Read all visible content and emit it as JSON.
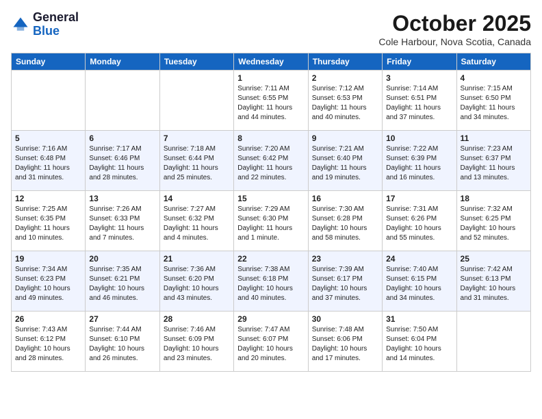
{
  "header": {
    "logo_general": "General",
    "logo_blue": "Blue",
    "title": "October 2025",
    "subtitle": "Cole Harbour, Nova Scotia, Canada"
  },
  "days": [
    "Sunday",
    "Monday",
    "Tuesday",
    "Wednesday",
    "Thursday",
    "Friday",
    "Saturday"
  ],
  "weeks": [
    [
      {
        "date": "",
        "content": ""
      },
      {
        "date": "",
        "content": ""
      },
      {
        "date": "",
        "content": ""
      },
      {
        "date": "1",
        "content": "Sunrise: 7:11 AM\nSunset: 6:55 PM\nDaylight: 11 hours\nand 44 minutes."
      },
      {
        "date": "2",
        "content": "Sunrise: 7:12 AM\nSunset: 6:53 PM\nDaylight: 11 hours\nand 40 minutes."
      },
      {
        "date": "3",
        "content": "Sunrise: 7:14 AM\nSunset: 6:51 PM\nDaylight: 11 hours\nand 37 minutes."
      },
      {
        "date": "4",
        "content": "Sunrise: 7:15 AM\nSunset: 6:50 PM\nDaylight: 11 hours\nand 34 minutes."
      }
    ],
    [
      {
        "date": "5",
        "content": "Sunrise: 7:16 AM\nSunset: 6:48 PM\nDaylight: 11 hours\nand 31 minutes."
      },
      {
        "date": "6",
        "content": "Sunrise: 7:17 AM\nSunset: 6:46 PM\nDaylight: 11 hours\nand 28 minutes."
      },
      {
        "date": "7",
        "content": "Sunrise: 7:18 AM\nSunset: 6:44 PM\nDaylight: 11 hours\nand 25 minutes."
      },
      {
        "date": "8",
        "content": "Sunrise: 7:20 AM\nSunset: 6:42 PM\nDaylight: 11 hours\nand 22 minutes."
      },
      {
        "date": "9",
        "content": "Sunrise: 7:21 AM\nSunset: 6:40 PM\nDaylight: 11 hours\nand 19 minutes."
      },
      {
        "date": "10",
        "content": "Sunrise: 7:22 AM\nSunset: 6:39 PM\nDaylight: 11 hours\nand 16 minutes."
      },
      {
        "date": "11",
        "content": "Sunrise: 7:23 AM\nSunset: 6:37 PM\nDaylight: 11 hours\nand 13 minutes."
      }
    ],
    [
      {
        "date": "12",
        "content": "Sunrise: 7:25 AM\nSunset: 6:35 PM\nDaylight: 11 hours\nand 10 minutes."
      },
      {
        "date": "13",
        "content": "Sunrise: 7:26 AM\nSunset: 6:33 PM\nDaylight: 11 hours\nand 7 minutes."
      },
      {
        "date": "14",
        "content": "Sunrise: 7:27 AM\nSunset: 6:32 PM\nDaylight: 11 hours\nand 4 minutes."
      },
      {
        "date": "15",
        "content": "Sunrise: 7:29 AM\nSunset: 6:30 PM\nDaylight: 11 hours\nand 1 minute."
      },
      {
        "date": "16",
        "content": "Sunrise: 7:30 AM\nSunset: 6:28 PM\nDaylight: 10 hours\nand 58 minutes."
      },
      {
        "date": "17",
        "content": "Sunrise: 7:31 AM\nSunset: 6:26 PM\nDaylight: 10 hours\nand 55 minutes."
      },
      {
        "date": "18",
        "content": "Sunrise: 7:32 AM\nSunset: 6:25 PM\nDaylight: 10 hours\nand 52 minutes."
      }
    ],
    [
      {
        "date": "19",
        "content": "Sunrise: 7:34 AM\nSunset: 6:23 PM\nDaylight: 10 hours\nand 49 minutes."
      },
      {
        "date": "20",
        "content": "Sunrise: 7:35 AM\nSunset: 6:21 PM\nDaylight: 10 hours\nand 46 minutes."
      },
      {
        "date": "21",
        "content": "Sunrise: 7:36 AM\nSunset: 6:20 PM\nDaylight: 10 hours\nand 43 minutes."
      },
      {
        "date": "22",
        "content": "Sunrise: 7:38 AM\nSunset: 6:18 PM\nDaylight: 10 hours\nand 40 minutes."
      },
      {
        "date": "23",
        "content": "Sunrise: 7:39 AM\nSunset: 6:17 PM\nDaylight: 10 hours\nand 37 minutes."
      },
      {
        "date": "24",
        "content": "Sunrise: 7:40 AM\nSunset: 6:15 PM\nDaylight: 10 hours\nand 34 minutes."
      },
      {
        "date": "25",
        "content": "Sunrise: 7:42 AM\nSunset: 6:13 PM\nDaylight: 10 hours\nand 31 minutes."
      }
    ],
    [
      {
        "date": "26",
        "content": "Sunrise: 7:43 AM\nSunset: 6:12 PM\nDaylight: 10 hours\nand 28 minutes."
      },
      {
        "date": "27",
        "content": "Sunrise: 7:44 AM\nSunset: 6:10 PM\nDaylight: 10 hours\nand 26 minutes."
      },
      {
        "date": "28",
        "content": "Sunrise: 7:46 AM\nSunset: 6:09 PM\nDaylight: 10 hours\nand 23 minutes."
      },
      {
        "date": "29",
        "content": "Sunrise: 7:47 AM\nSunset: 6:07 PM\nDaylight: 10 hours\nand 20 minutes."
      },
      {
        "date": "30",
        "content": "Sunrise: 7:48 AM\nSunset: 6:06 PM\nDaylight: 10 hours\nand 17 minutes."
      },
      {
        "date": "31",
        "content": "Sunrise: 7:50 AM\nSunset: 6:04 PM\nDaylight: 10 hours\nand 14 minutes."
      },
      {
        "date": "",
        "content": ""
      }
    ]
  ]
}
